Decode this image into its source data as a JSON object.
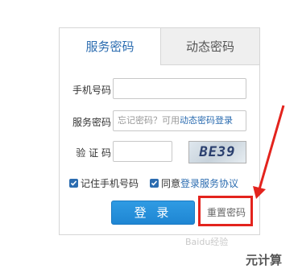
{
  "tabs": {
    "active": "服务密码",
    "inactive": "动态密码"
  },
  "form": {
    "phone_label": "手机号码",
    "phone_value": "",
    "password_label": "服务密码",
    "password_hint": "忘记密码？可用",
    "password_link": "动态密码登录",
    "captcha_label": "验 证 码",
    "captcha_value": "",
    "captcha_text": "BE39",
    "remember_label": "记住手机号码",
    "agree_prefix": "同意",
    "agree_link": "登录服务协议",
    "remember_checked": true,
    "agree_checked": true
  },
  "buttons": {
    "login": "登 录",
    "reset": "重置密码"
  },
  "colors": {
    "accent": "#2b6cb0",
    "login_button": "#1f86d3",
    "highlight": "#e3231d"
  },
  "overlay": {
    "watermark": "Baidu经验",
    "corner_text": "元计算"
  }
}
